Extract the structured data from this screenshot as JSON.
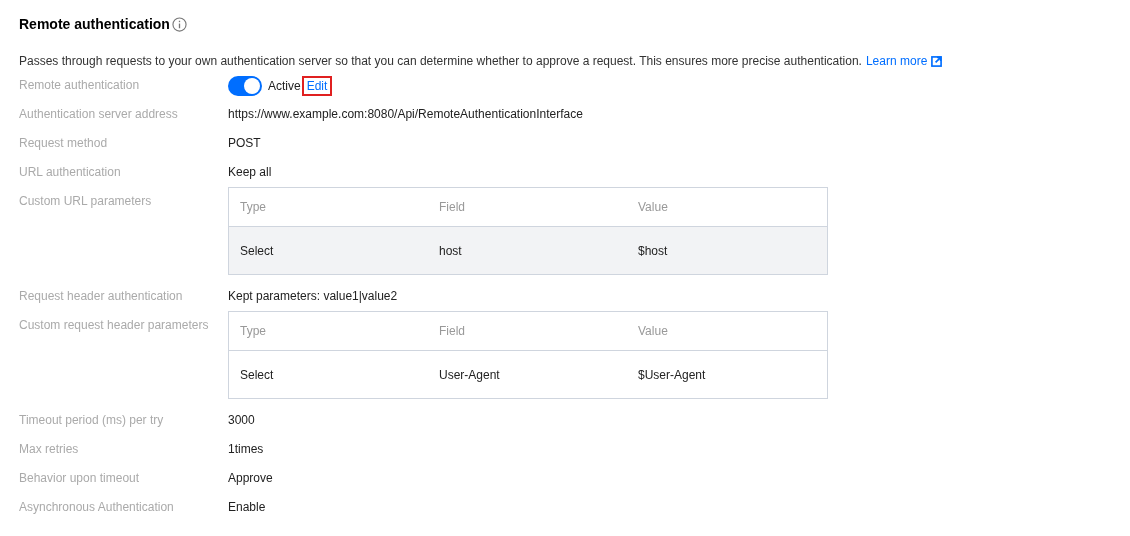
{
  "title": "Remote authentication",
  "description": "Passes through requests to your own authentication server so that you can determine whether to approve a request. This ensures more precise authentication.",
  "learn_more": "Learn more",
  "fields": [
    {
      "kind": "toggle",
      "label": "Remote authentication",
      "on": true,
      "value": "Active",
      "edit": {
        "label": "Edit",
        "highlighted": true
      }
    },
    {
      "kind": "text",
      "label": "Authentication server address",
      "value": "https://www.example.com:8080/Api/RemoteAuthenticationInterface"
    },
    {
      "kind": "text",
      "label": "Request method",
      "value": "POST"
    },
    {
      "kind": "text",
      "label": "URL authentication",
      "value": "Keep all"
    },
    {
      "kind": "table",
      "label": "Custom URL parameters",
      "columns": [
        "Type",
        "Field",
        "Value"
      ],
      "rows": [
        {
          "cells": [
            "Select",
            "host",
            "$host"
          ],
          "highlighted": true
        }
      ]
    },
    {
      "kind": "text",
      "label": "Request header authentication",
      "value": "Kept parameters: value1|value2"
    },
    {
      "kind": "table",
      "label": "Custom request header parameters",
      "columns": [
        "Type",
        "Field",
        "Value"
      ],
      "rows": [
        {
          "cells": [
            "Select",
            "User-Agent",
            "$User-Agent"
          ],
          "highlighted": false
        }
      ]
    },
    {
      "kind": "text",
      "label": "Timeout period (ms) per try",
      "value": "3000"
    },
    {
      "kind": "text",
      "label": "Max retries",
      "value": "1times"
    },
    {
      "kind": "text",
      "label": "Behavior upon timeout",
      "value": "Approve"
    },
    {
      "kind": "text",
      "label": "Asynchronous Authentication",
      "value": "Enable"
    }
  ]
}
